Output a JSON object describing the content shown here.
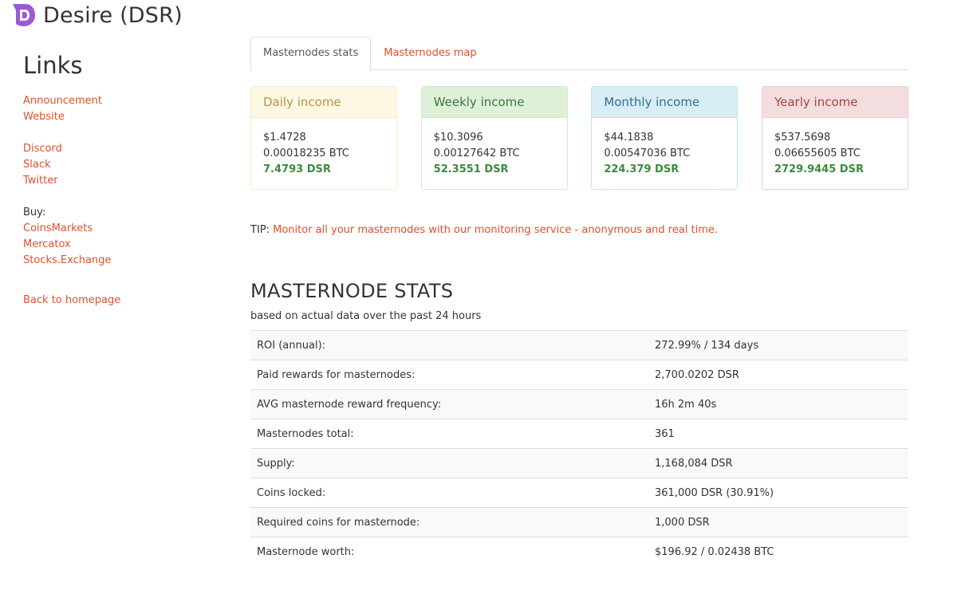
{
  "header": {
    "title": "Desire (DSR)"
  },
  "sidebar": {
    "heading": "Links",
    "group1": [
      "Announcement",
      "Website"
    ],
    "group2": [
      "Discord",
      "Slack",
      "Twitter"
    ],
    "buy_label": "Buy:",
    "group3": [
      "CoinsMarkets",
      "Mercatox",
      "Stocks.Exchange"
    ],
    "back": "Back to homepage"
  },
  "tabs": [
    {
      "label": "Masternodes stats",
      "active": true
    },
    {
      "label": "Masternodes map",
      "active": false
    }
  ],
  "cards": [
    {
      "title": "Daily income",
      "usd": "$1.4728",
      "btc": "0.00018235 BTC",
      "dsr": "7.4793 DSR"
    },
    {
      "title": "Weekly income",
      "usd": "$10.3096",
      "btc": "0.00127642 BTC",
      "dsr": "52.3551 DSR"
    },
    {
      "title": "Monthly income",
      "usd": "$44.1838",
      "btc": "0.00547036 BTC",
      "dsr": "224.379 DSR"
    },
    {
      "title": "Yearly income",
      "usd": "$537.5698",
      "btc": "0.06655605 BTC",
      "dsr": "2729.9445 DSR"
    }
  ],
  "tip": {
    "prefix": "TIP:",
    "link": "Monitor all your masternodes with our monitoring service - anonymous and real time."
  },
  "stats": {
    "title": "MASTERNODE STATS",
    "subtitle": "based on actual data over the past 24 hours",
    "rows": [
      {
        "label": "ROI (annual):",
        "value": "272.99% / 134 days"
      },
      {
        "label": "Paid rewards for masternodes:",
        "value": "2,700.0202 DSR"
      },
      {
        "label": "AVG masternode reward frequency:",
        "value": "16h 2m 40s"
      },
      {
        "label": "Masternodes total:",
        "value": "361"
      },
      {
        "label": "Supply:",
        "value": "1,168,084 DSR"
      },
      {
        "label": "Coins locked:",
        "value": "361,000 DSR (30.91%)"
      },
      {
        "label": "Required coins for masternode:",
        "value": "1,000 DSR"
      },
      {
        "label": "Masternode worth:",
        "value": "$196.92 / 0.02438 BTC"
      }
    ]
  }
}
